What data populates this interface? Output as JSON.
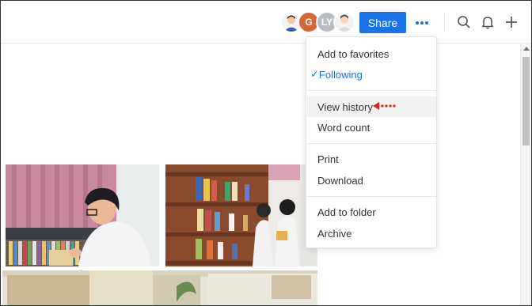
{
  "header": {
    "share_label": "Share",
    "collaborators": [
      {
        "initials": "",
        "color": "#f3f3f3"
      },
      {
        "initials": "G",
        "color": "#d8643a"
      },
      {
        "initials": "LY",
        "color": "#b8bcc2"
      },
      {
        "initials": "",
        "color": "#f3f3f3"
      }
    ],
    "icons": [
      "more-options-icon",
      "search-icon",
      "bell-icon",
      "plus-icon"
    ]
  },
  "menu": {
    "items": [
      {
        "label": "Add to favorites"
      },
      {
        "label": "Following",
        "checked": true
      },
      {
        "label": "View history",
        "highlighted": true
      },
      {
        "label": "Word count"
      },
      {
        "label": "Print"
      },
      {
        "label": "Download"
      },
      {
        "label": "Add to folder"
      },
      {
        "label": "Archive"
      }
    ],
    "check_mark": "✓"
  },
  "colors": {
    "accent": "#1a73e8",
    "annotation_arrow": "#e02020"
  }
}
